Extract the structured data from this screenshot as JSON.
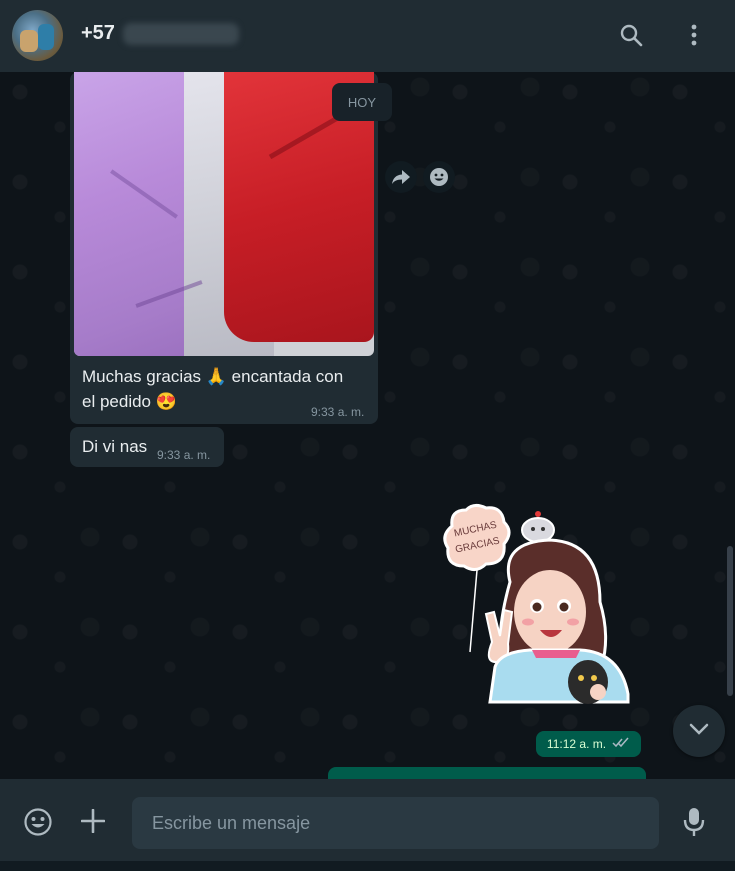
{
  "header": {
    "contact_prefix": "+57"
  },
  "chat": {
    "date_label": "HOY",
    "messages": [
      {
        "text_line1": "Muchas gracias 🙏 encantada con",
        "text_line2": "el pedido 😍",
        "time": "9:33 a. m."
      },
      {
        "text": "Di vi nas",
        "time": "9:33 a. m."
      }
    ],
    "sticker": {
      "text_line1": "MUCHAS",
      "text_line2": "GRACIAS"
    },
    "outgoing_time": "11:12 a. m."
  },
  "composer": {
    "placeholder": "Escribe un mensaje"
  },
  "colors": {
    "header_bg": "#202c33",
    "chat_bg": "#0b141a",
    "incoming_bubble": "#202c33",
    "outgoing_bubble": "#005c4b",
    "read_ticks": "#53bdeb"
  }
}
